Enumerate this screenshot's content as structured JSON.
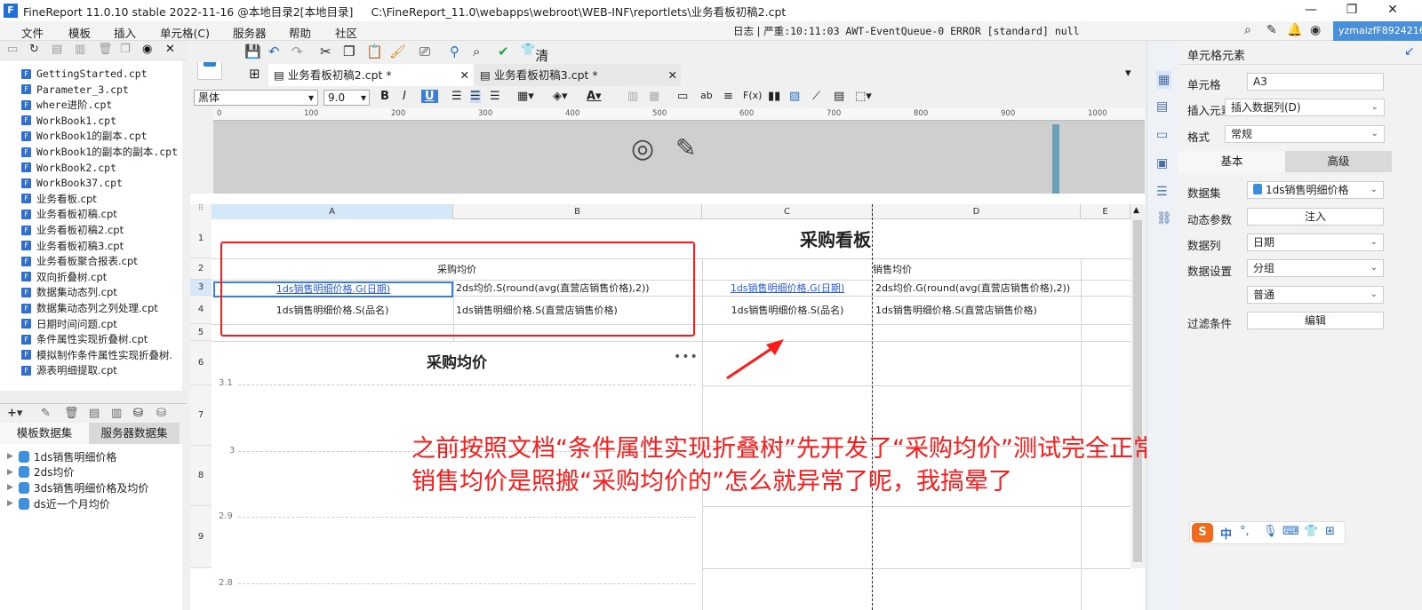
{
  "window": {
    "title": "FineReport 11.0.10 stable 2022-11-16 @本地目录2[本地目录]",
    "path": "C:\\FineReport_11.0\\webapps\\webroot\\WEB-INF\\reportlets\\业务看板初稿2.cpt",
    "logo": "F"
  },
  "menu": [
    "文件",
    "模板",
    "插入",
    "单元格(C)",
    "服务器",
    "帮助",
    "社区"
  ],
  "log": {
    "label": "日志",
    "text": "严重:10:11:03 AWT-EventQueue-0 ERROR [standard] null"
  },
  "user": "yzmaizfF8924216",
  "files": [
    "GettingStarted.cpt",
    "Parameter_3.cpt",
    "where进阶.cpt",
    "WorkBook1.cpt",
    "WorkBook1的副本.cpt",
    "WorkBook1的副本的副本.cpt",
    "WorkBook2.cpt",
    "WorkBook37.cpt",
    "业务看板.cpt",
    "业务看板初稿.cpt",
    "业务看板初稿2.cpt",
    "业务看板初稿3.cpt",
    "业务看板聚合报表.cpt",
    "双向折叠树.cpt",
    "数据集动态列.cpt",
    "数据集动态列之列处理.cpt",
    "日期时间问题.cpt",
    "条件属性实现折叠树.cpt",
    "模拟制作条件属性实现折叠树.",
    "源表明细提取.cpt"
  ],
  "ds_tabs": [
    "模板数据集",
    "服务器数据集"
  ],
  "datasets": [
    "1ds销售明细价格",
    "2ds均价",
    "3ds销售明细价格及均价",
    "ds近一个月均价"
  ],
  "toolbar": {
    "brand": "清爽科技"
  },
  "tabs": [
    {
      "label": "业务看板初稿2.cpt *"
    },
    {
      "label": "业务看板初稿3.cpt *"
    }
  ],
  "format": {
    "font": "黑体",
    "size": "9.0"
  },
  "ruler": [
    "0",
    "100",
    "200",
    "300",
    "400",
    "500",
    "600",
    "700",
    "800",
    "900",
    "1000"
  ],
  "columns": [
    "A",
    "B",
    "C",
    "D",
    "E"
  ],
  "rows": [
    "1",
    "2",
    "3",
    "4",
    "5",
    "6",
    "7",
    "8",
    "9"
  ],
  "cells": {
    "title": "采购看板",
    "b2": "采购均价",
    "d2": "销售均价",
    "a3": "1ds销售明细价格.G(日期)",
    "b3": "2ds均价.S(round(avg(直营店销售价格),2))",
    "c3": "1ds销售明细价格.G(日期)",
    "d3": "2ds均价.G(round(avg(直营店销售价格),2))",
    "a4": "1ds销售明细价格.S(品名)",
    "b4": "1ds销售明细价格.S(直营店销售价格)",
    "c4": "1ds销售明细价格.S(品名)",
    "d4": "1ds销售明细价格.S(直营店销售价格)"
  },
  "chart_data": {
    "type": "line",
    "title": "采购均价",
    "y_ticks": [
      "3.1",
      "3",
      "2.9",
      "2.8"
    ],
    "more": "•••"
  },
  "annotation": {
    "line1": "之前按照文档“条件属性实现折叠树”先开发了“采购均价”测试完全正常",
    "line2": "销售均价是照搬“采购均价的”怎么就异常了呢，我搞晕了",
    "color": "#ff1a1a"
  },
  "panel": {
    "title": "单元格元素",
    "cell_label": "单元格",
    "cell_value": "A3",
    "insert_label": "插入元素",
    "insert_value": "插入数据列(D)",
    "format_label": "格式",
    "format_value": "常规",
    "tab_basic": "基本",
    "tab_adv": "高级",
    "dataset_label": "数据集",
    "dataset_value": "1ds销售明细价格",
    "param_label": "动态参数",
    "param_btn": "注入",
    "column_label": "数据列",
    "column_value": "日期",
    "setting_label": "数据设置",
    "setting_value": "分组",
    "setting_value2": "普通",
    "filter_label": "过滤条件",
    "filter_btn": "编辑"
  },
  "ime": {
    "logo": "S",
    "lang": "中"
  }
}
